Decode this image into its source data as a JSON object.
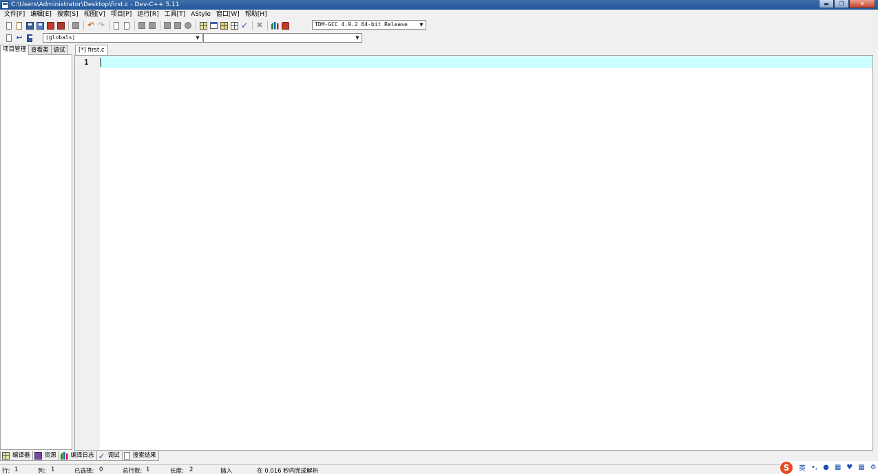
{
  "window": {
    "title": "C:\\Users\\Administrator\\Desktop\\first.c - Dev-C++ 5.11",
    "controls": [
      "minimize",
      "restore",
      "close"
    ]
  },
  "menu": [
    "文件[F]",
    "编辑[E]",
    "搜索[S]",
    "视图[V]",
    "项目[P]",
    "运行[R]",
    "工具[T]",
    "AStyle",
    "窗口[W]",
    "帮助[H]"
  ],
  "toolbar": {
    "compiler_select": "TDM-GCC 4.9.2 64-bit Release",
    "scope_select": "(globals)",
    "member_select": ""
  },
  "left_panel": {
    "tabs": [
      "项目管理",
      "查看类",
      "调试"
    ],
    "active_tab": 0
  },
  "editor": {
    "tab_label": "[*] first.c",
    "line_numbers": [
      "1"
    ],
    "current_line_color": "#ccffff"
  },
  "bottom_tabs": [
    "编译器",
    "资源",
    "编译日志",
    "调试",
    "搜索结果"
  ],
  "status": {
    "row_label": "行:",
    "row_value": "1",
    "col_label": "列:",
    "col_value": "1",
    "selected_label": "已选择:",
    "selected_value": "0",
    "total_lines_label": "总行数:",
    "total_lines_value": "1",
    "length_label": "长度:",
    "length_value": "2",
    "mode": "插入",
    "parse_message": "在 0.016 秒内完成解析"
  },
  "ime": {
    "logo": "S",
    "lang": "英"
  }
}
